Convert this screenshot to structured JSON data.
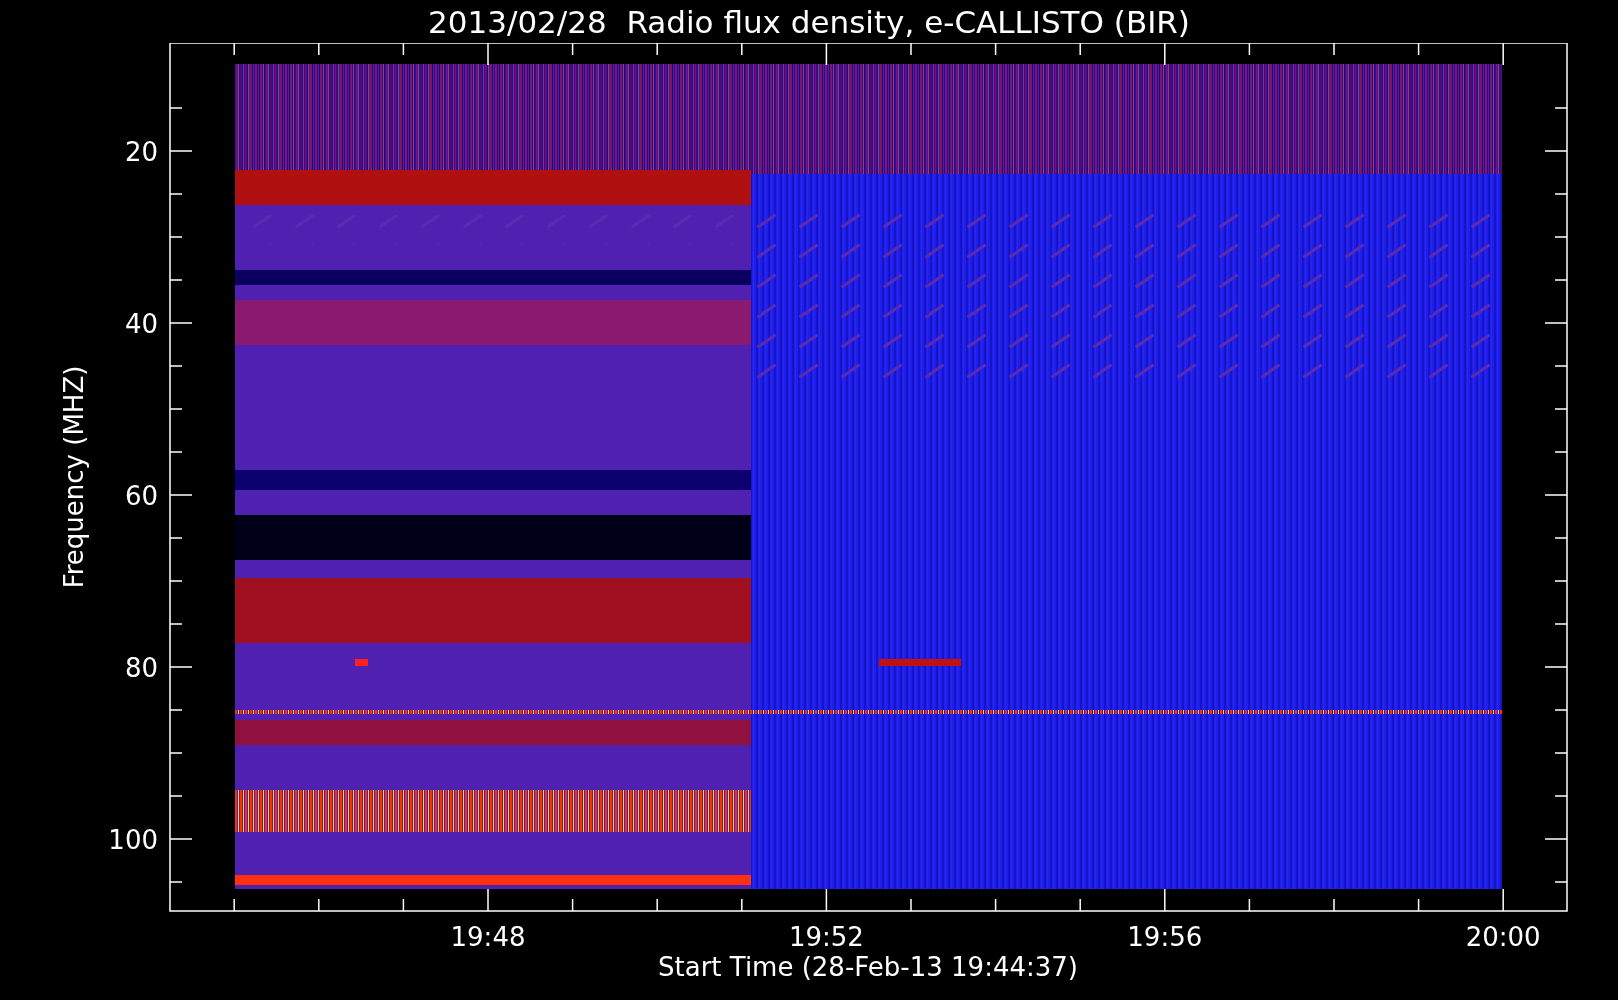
{
  "title": "2013/02/28  Radio flux density, e-CALLISTO (BIR)",
  "y_axis": {
    "label": "Frequency (MHZ)",
    "ticks": [
      "20",
      "40",
      "60",
      "80",
      "100"
    ]
  },
  "x_axis": {
    "label": "Start Time (28-Feb-13 19:44:37)",
    "ticks": [
      "19:48",
      "19:52",
      "19:56",
      "20:00"
    ]
  }
}
